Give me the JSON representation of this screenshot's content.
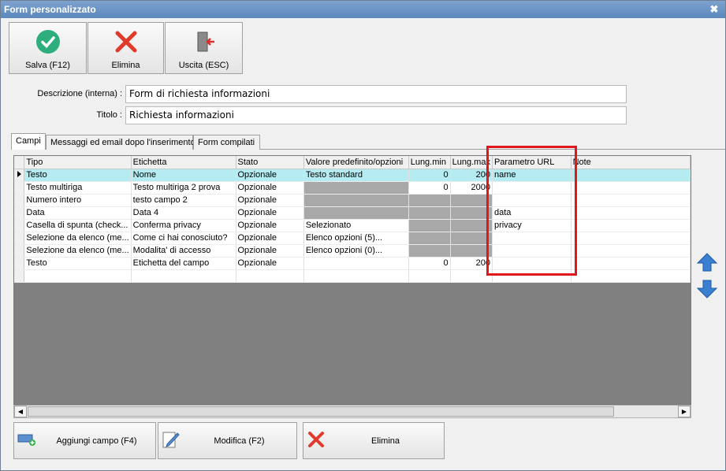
{
  "window": {
    "title": "Form personalizzato"
  },
  "toolbar": {
    "save_label": "Salva (F12)",
    "delete_label": "Elimina",
    "exit_label": "Uscita (ESC)"
  },
  "form": {
    "description_label": "Descrizione (interna) :",
    "description_value": "Form di richiesta informazioni",
    "title_label": "Titolo :",
    "title_value": "Richiesta informazioni"
  },
  "tabs": [
    "Campi",
    "Messaggi ed email dopo l'inserimento",
    "Form compilati"
  ],
  "grid": {
    "columns": [
      "Tipo",
      "Etichetta",
      "Stato",
      "Valore predefinito/opzioni",
      "Lung.min",
      "Lung.max",
      "Parametro URL",
      "Note"
    ],
    "rows": [
      [
        "Testo",
        "Nome",
        "Opzionale",
        "Testo standard",
        "0",
        "200",
        "name",
        ""
      ],
      [
        "Testo multiriga",
        "Testo multiriga 2 prova",
        "Opzionale",
        "",
        "0",
        "2000",
        "",
        ""
      ],
      [
        "Numero intero",
        "testo campo 2",
        "Opzionale",
        "",
        "",
        "",
        "",
        ""
      ],
      [
        "Data",
        "Data 4",
        "Opzionale",
        "",
        "",
        "",
        "data",
        ""
      ],
      [
        "Casella di spunta (check...",
        "Conferma privacy",
        "Opzionale",
        "Selezionato",
        "",
        "",
        "privacy",
        ""
      ],
      [
        "Selezione da elenco (me...",
        "Come ci hai conosciuto?",
        "Opzionale",
        "Elenco opzioni (5)...",
        "",
        "",
        "",
        ""
      ],
      [
        "Selezione da elenco (me...",
        "Modalita' di accesso",
        "Opzionale",
        "Elenco opzioni (0)...",
        "",
        "",
        "",
        ""
      ],
      [
        "Testo",
        "Etichetta del campo",
        "Opzionale",
        "",
        "0",
        "200",
        "",
        ""
      ]
    ]
  },
  "bottom": {
    "add_label": "Aggiungi campo (F4)",
    "edit_label": "Modifica (F2)",
    "delete_label": "Elimina"
  },
  "colors": {
    "selection": "#b4ecf1",
    "highlight_box": "#e0181b",
    "title_bar": "#6b93c6"
  },
  "icons": [
    "check-icon",
    "delete-x-icon",
    "exit-door-icon",
    "close-icon",
    "move-up-icon",
    "move-down-icon",
    "add-field-icon",
    "edit-icon"
  ]
}
